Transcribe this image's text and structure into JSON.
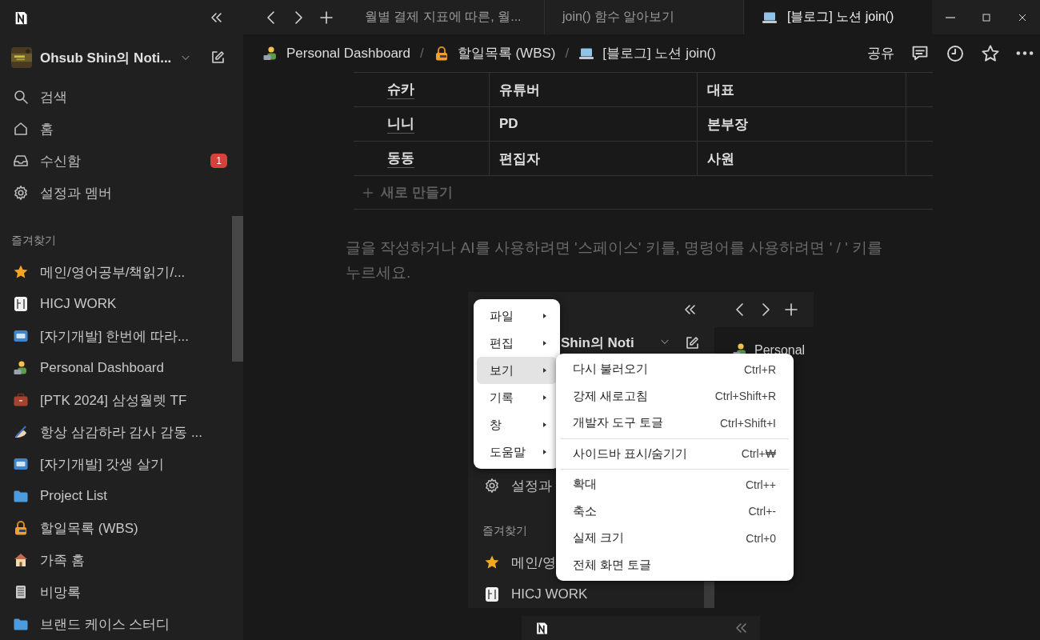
{
  "sidebar": {
    "workspace": "Ohsub Shin의 Noti...",
    "nav": [
      {
        "label": "검색"
      },
      {
        "label": "홈"
      },
      {
        "label": "수신함",
        "badge": "1"
      },
      {
        "label": "설정과 멤버"
      }
    ],
    "favorites_title": "즐겨찾기",
    "favorites": [
      {
        "label": "메인/영어공부/책읽기/..."
      },
      {
        "label": "HICJ WORK"
      },
      {
        "label": "[자기개발] 한번에 따라..."
      },
      {
        "label": "Personal Dashboard"
      },
      {
        "label": "[PTK 2024] 삼성월렛 TF"
      },
      {
        "label": "항상 삼감하라 감사 감동 ..."
      },
      {
        "label": "[자기개발] 갓생 살기"
      },
      {
        "label": "Project List"
      },
      {
        "label": "할일목록 (WBS)"
      },
      {
        "label": "가족 홈"
      },
      {
        "label": "비망록"
      },
      {
        "label": "브랜드 케이스 스터디"
      }
    ]
  },
  "tabs": [
    {
      "label": "월별 결제 지표에 따른, 월...",
      "selected": false
    },
    {
      "label": "join() 함수 알아보기",
      "selected": false
    },
    {
      "label": "[블로그] 노션 join()",
      "selected": true
    }
  ],
  "breadcrumb": [
    {
      "kind": "link",
      "label": "Personal Dashboard"
    },
    {
      "kind": "separator",
      "label": "/"
    },
    {
      "kind": "link",
      "label": "할일목록 (WBS)"
    },
    {
      "kind": "separator",
      "label": "/"
    },
    {
      "kind": "link",
      "label": "[블로그] 노션 join()"
    }
  ],
  "share": "공유",
  "table": {
    "rows": [
      [
        "슈카",
        "유튜버",
        "대표"
      ],
      [
        "니니",
        "PD",
        "본부장"
      ],
      [
        "동동",
        "편집자",
        "사원"
      ]
    ],
    "new_row": "새로 만들기"
  },
  "placeholder": "글을 작성하거나 AI를 사용하려면 '스페이스' 키를, 명령어를 사용하려면 ' / ' 키를 누르세요.",
  "embedded": {
    "kind": "screenshot",
    "workspace": "Shin의 Noti",
    "settings": "설정과",
    "favorites_title": "즐겨찾기",
    "favorites": [
      {
        "label": "메인/영"
      },
      {
        "label": "HICJ WORK"
      }
    ],
    "page": "Personal",
    "menu": [
      {
        "label": "파일",
        "selected": false
      },
      {
        "label": "편집",
        "selected": false
      },
      {
        "label": "보기",
        "selected": true
      },
      {
        "label": "기록",
        "selected": false
      },
      {
        "label": "창",
        "selected": false
      },
      {
        "label": "도움말",
        "selected": false
      }
    ],
    "submenu": [
      [
        {
          "label": "다시 불러오기",
          "shortcut": "Ctrl+R"
        },
        {
          "label": "강제 새로고침",
          "shortcut": "Ctrl+Shift+R"
        },
        {
          "label": "개발자 도구 토글",
          "shortcut": "Ctrl+Shift+I"
        }
      ],
      [
        {
          "label": "사이드바 표시/숨기기",
          "shortcut": "Ctrl+₩"
        }
      ],
      [
        {
          "label": "확대",
          "shortcut": "Ctrl++"
        },
        {
          "label": "축소",
          "shortcut": "Ctrl+-"
        },
        {
          "label": "실제 크기",
          "shortcut": "Ctrl+0"
        },
        {
          "label": "전체 화면 토글"
        }
      ]
    ]
  }
}
